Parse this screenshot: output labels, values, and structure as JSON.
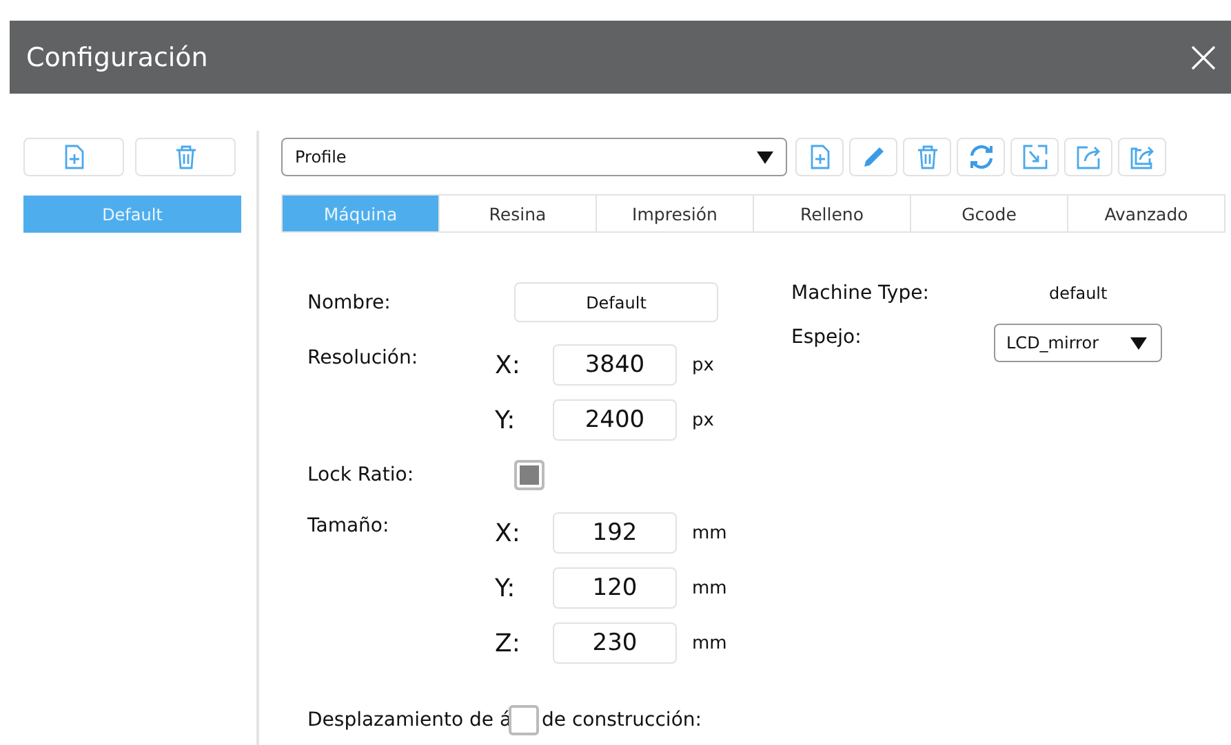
{
  "window": {
    "title": "Configuración"
  },
  "profile_buttons": [
    {
      "kind": "new"
    },
    {
      "kind": "delete"
    }
  ],
  "profiles": [
    {
      "name": "Default",
      "selected": true
    }
  ],
  "profile_select": {
    "value": "Profile"
  },
  "toolbar": [
    {
      "kind": "new"
    },
    {
      "kind": "edit"
    },
    {
      "kind": "delete"
    },
    {
      "kind": "refresh"
    },
    {
      "kind": "import"
    },
    {
      "kind": "export"
    },
    {
      "kind": "export_all"
    }
  ],
  "tabs": [
    {
      "label": "Máquina",
      "selected": true
    },
    {
      "label": "Resina",
      "selected": false
    },
    {
      "label": "Impresión",
      "selected": false
    },
    {
      "label": "Relleno",
      "selected": false
    },
    {
      "label": "Gcode",
      "selected": false
    },
    {
      "label": "Avanzado",
      "selected": false
    }
  ],
  "form": {
    "name": {
      "label": "Nombre:",
      "value": "Default"
    },
    "resolution": {
      "label": "Resolución:",
      "axes": [
        {
          "axis": "X:",
          "value": "3840",
          "unit": "px"
        },
        {
          "axis": "Y:",
          "value": "2400",
          "unit": "px"
        }
      ]
    },
    "lock_ratio": {
      "label": "Lock Ratio:",
      "checked": true
    },
    "size": {
      "label": "Tamaño:",
      "axes": [
        {
          "axis": "X:",
          "value": "192",
          "unit": "mm"
        },
        {
          "axis": "Y:",
          "value": "120",
          "unit": "mm"
        },
        {
          "axis": "Z:",
          "value": "230",
          "unit": "mm"
        }
      ]
    },
    "offset": {
      "label_before": "Desplazamiento de á",
      "label_after": "de construcción:",
      "checked": false
    },
    "machine_type": {
      "label": "Machine Type:",
      "value": "default"
    },
    "mirror": {
      "label": "Espejo:",
      "value": "LCD_mirror"
    }
  }
}
